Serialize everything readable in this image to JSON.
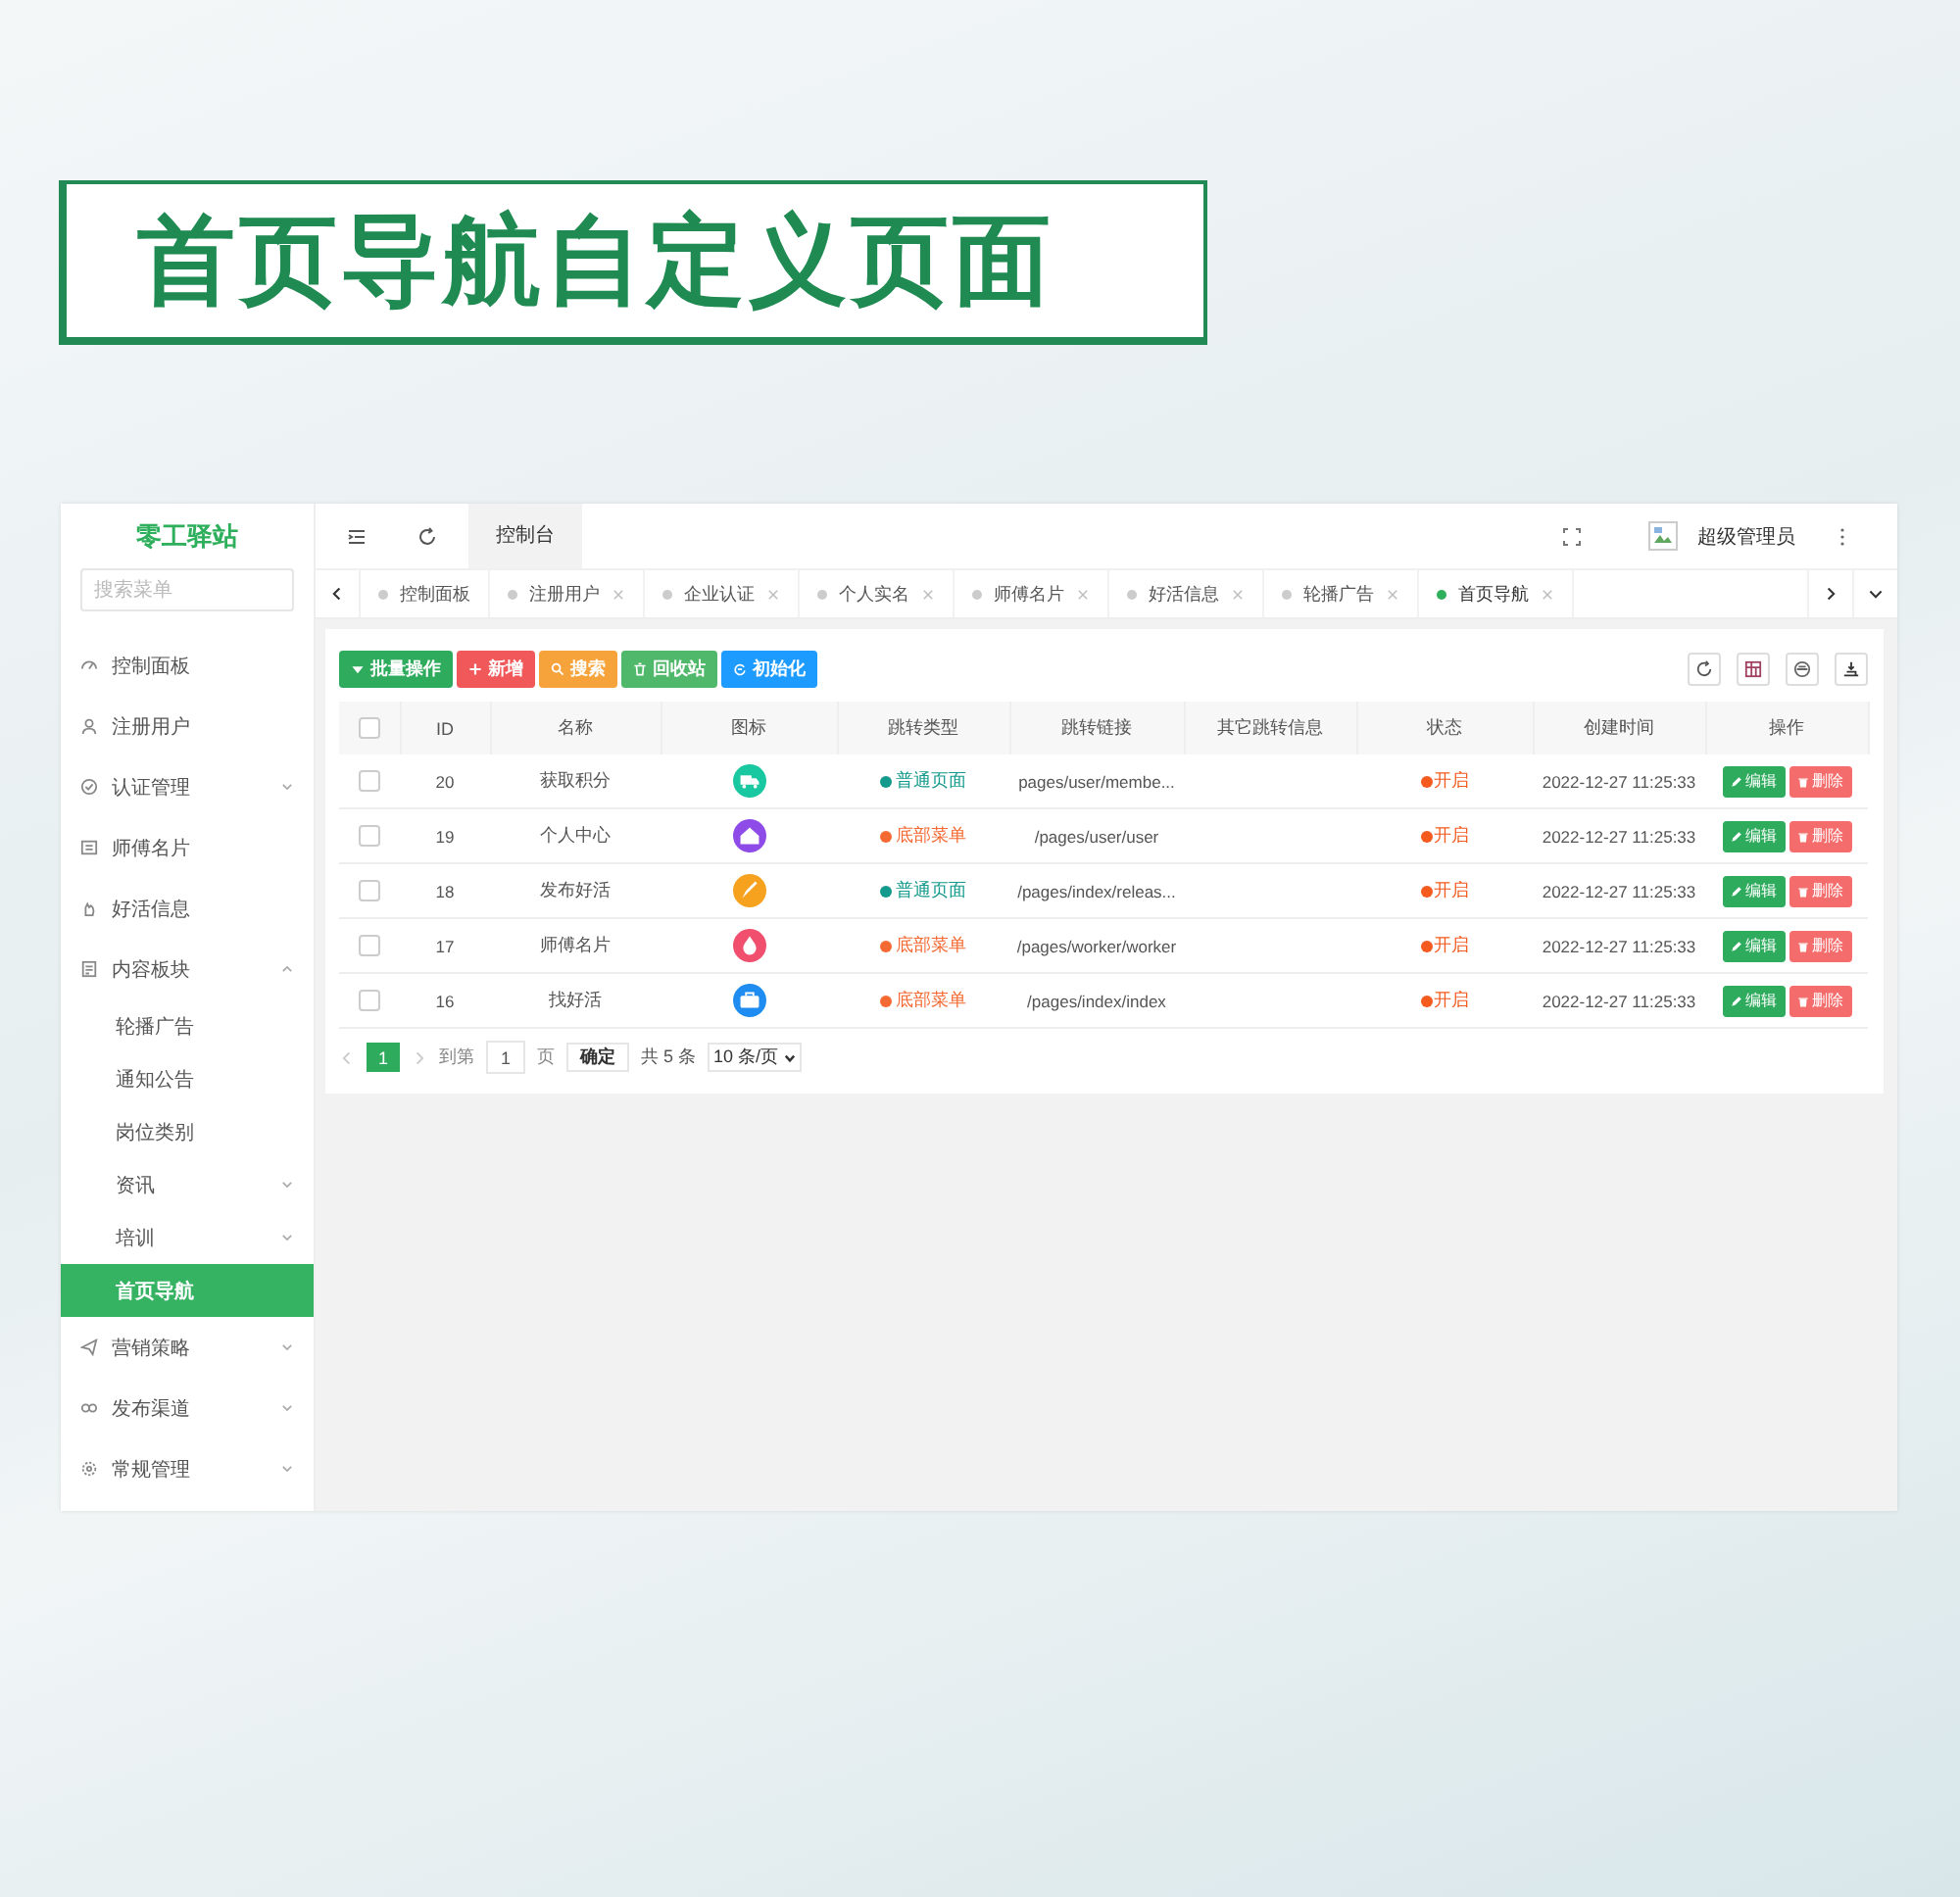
{
  "banner": {
    "title": "首页导航自定义页面"
  },
  "sidebar": {
    "logo": "零工驿站",
    "search": {
      "placeholder": "搜索菜单"
    },
    "items": [
      {
        "label": "控制面板",
        "kind": "link",
        "selected": false
      },
      {
        "label": "注册用户",
        "kind": "link",
        "selected": false
      },
      {
        "label": "认证管理",
        "kind": "group",
        "expanded": false,
        "selected": false
      },
      {
        "label": "师傅名片",
        "kind": "link",
        "selected": false
      },
      {
        "label": "好活信息",
        "kind": "link",
        "selected": false
      },
      {
        "label": "内容板块",
        "kind": "group",
        "expanded": true,
        "selected": false,
        "children": [
          {
            "label": "轮播广告",
            "kind": "link",
            "selected": false
          },
          {
            "label": "通知公告",
            "kind": "link",
            "selected": false
          },
          {
            "label": "岗位类别",
            "kind": "link",
            "selected": false
          },
          {
            "label": "资讯",
            "kind": "group",
            "expanded": false,
            "selected": false
          },
          {
            "label": "培训",
            "kind": "group",
            "expanded": false,
            "selected": false
          },
          {
            "label": "首页导航",
            "kind": "link",
            "selected": true
          }
        ]
      },
      {
        "label": "营销策略",
        "kind": "group",
        "expanded": false,
        "selected": false
      },
      {
        "label": "发布渠道",
        "kind": "group",
        "expanded": false,
        "selected": false
      },
      {
        "label": "常规管理",
        "kind": "group",
        "expanded": false,
        "selected": false
      }
    ]
  },
  "topbar": {
    "page_tab": "控制台",
    "user": "超级管理员"
  },
  "tabs": [
    {
      "label": "控制面板",
      "selected": false,
      "closable": false
    },
    {
      "label": "注册用户",
      "selected": false,
      "closable": true
    },
    {
      "label": "企业认证",
      "selected": false,
      "closable": true
    },
    {
      "label": "个人实名",
      "selected": false,
      "closable": true
    },
    {
      "label": "师傅名片",
      "selected": false,
      "closable": true
    },
    {
      "label": "好活信息",
      "selected": false,
      "closable": true
    },
    {
      "label": "轮播广告",
      "selected": false,
      "closable": true
    },
    {
      "label": "首页导航",
      "selected": true,
      "closable": true
    }
  ],
  "toolbar": [
    {
      "label": "批量操作",
      "kind": "batch"
    },
    {
      "label": "新增",
      "kind": "add"
    },
    {
      "label": "搜索",
      "kind": "search"
    },
    {
      "label": "回收站",
      "kind": "recycle"
    },
    {
      "label": "初始化",
      "kind": "init"
    }
  ],
  "table": {
    "header_checked": false,
    "columns": [
      "ID",
      "名称",
      "图标",
      "跳转类型",
      "跳转链接",
      "其它跳转信息",
      "状态",
      "创建时间",
      "操作"
    ],
    "rows": [
      {
        "checked": false,
        "id": "20",
        "name": "获取积分",
        "color": "#19c8a0",
        "jump_type": {
          "label": "普通页面",
          "kind": "page"
        },
        "link": "pages/user/membe...",
        "status": {
          "label": "开启",
          "on": true
        },
        "created": "2022-12-27 11:25:33",
        "actions": [
          "编辑",
          "删除"
        ]
      },
      {
        "checked": false,
        "id": "19",
        "name": "个人中心",
        "color": "#8e4be8",
        "jump_type": {
          "label": "底部菜单",
          "kind": "tab"
        },
        "link": "/pages/user/user",
        "status": {
          "label": "开启",
          "on": true
        },
        "created": "2022-12-27 11:25:33",
        "actions": [
          "编辑",
          "删除"
        ]
      },
      {
        "checked": false,
        "id": "18",
        "name": "发布好活",
        "color": "#f7a21e",
        "jump_type": {
          "label": "普通页面",
          "kind": "page"
        },
        "link": "/pages/index/releas...",
        "status": {
          "label": "开启",
          "on": true
        },
        "created": "2022-12-27 11:25:33",
        "actions": [
          "编辑",
          "删除"
        ]
      },
      {
        "checked": false,
        "id": "17",
        "name": "师傅名片",
        "color": "#f0506e",
        "jump_type": {
          "label": "底部菜单",
          "kind": "tab"
        },
        "link": "/pages/worker/worker",
        "status": {
          "label": "开启",
          "on": true
        },
        "created": "2022-12-27 11:25:33",
        "actions": [
          "编辑",
          "删除"
        ]
      },
      {
        "checked": false,
        "id": "16",
        "name": "找好活",
        "color": "#1e8cf0",
        "jump_type": {
          "label": "底部菜单",
          "kind": "tab"
        },
        "link": "/pages/index/index",
        "status": {
          "label": "开启",
          "on": true
        },
        "created": "2022-12-27 11:25:33",
        "actions": [
          "编辑",
          "删除"
        ]
      }
    ]
  },
  "pagination": {
    "pages": [
      {
        "label": "1",
        "selected": true
      }
    ],
    "goto_label": "到第",
    "goto_value": "1",
    "page_unit": "页",
    "confirm": "确定",
    "total": "共 5 条",
    "page_size": "10 条/页"
  }
}
